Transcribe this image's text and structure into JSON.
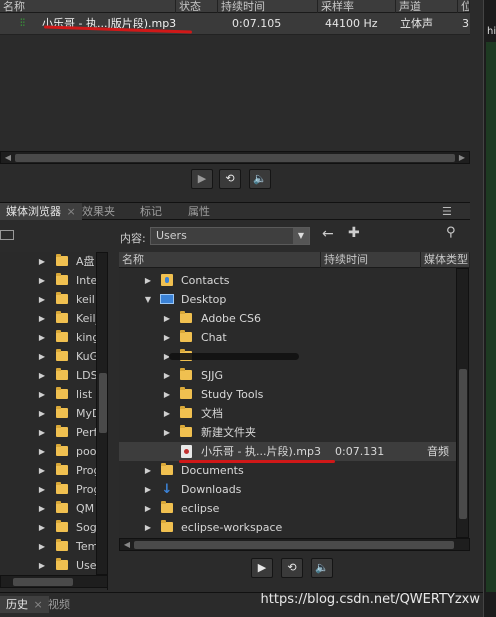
{
  "top_panel": {
    "columns": [
      "名称",
      "状态",
      "持续时间",
      "采样率",
      "声道",
      "位",
      "3"
    ],
    "file": {
      "name": "小乐哥 - 执...J版片段).mp3",
      "duration": "0:07.105",
      "sample_rate": "44100 Hz",
      "channels": "立体声",
      "bits": "3"
    },
    "transport": [
      "play-icon",
      "loop-icon",
      "volume-icon"
    ]
  },
  "tabs": {
    "media_browser": "媒体浏览器",
    "media_browser_close": "×",
    "effects": "效果夹",
    "markers": "标记",
    "properties": "属性",
    "menu": "☰"
  },
  "content": {
    "label": "内容:",
    "location": "Users"
  },
  "left_tree": {
    "items": [
      "A盘",
      "Inte",
      "keil",
      "Keil_",
      "king",
      "KuG",
      "LDS",
      "list",
      "MyD",
      "Perf",
      "pool",
      "Prog",
      "Prog",
      "QM",
      "Sog",
      "Tem",
      "Use"
    ]
  },
  "list": {
    "header": {
      "name": "名称",
      "duration": "持续时间",
      "media_type": "媒体类型"
    },
    "rows": [
      {
        "name": "Contacts",
        "type": "contacts"
      },
      {
        "name": "Desktop",
        "type": "desktop"
      },
      {
        "name": "Adobe CS6",
        "type": "folder"
      },
      {
        "name": "Chat",
        "type": "folder"
      },
      {
        "name": "",
        "type": "folder"
      },
      {
        "name": "SJJG",
        "type": "folder"
      },
      {
        "name": "Study Tools",
        "type": "folder"
      },
      {
        "name": "文档",
        "type": "folder"
      },
      {
        "name": "新建文件夹",
        "type": "folder"
      },
      {
        "name": "小乐哥 - 执...片段).mp3",
        "type": "file",
        "duration": "0:07.131",
        "media_type": "音频"
      },
      {
        "name": "Documents",
        "type": "folder"
      },
      {
        "name": "Downloads",
        "type": "downloads"
      },
      {
        "name": "eclipse",
        "type": "folder"
      },
      {
        "name": "eclipse-workspace",
        "type": "folder"
      }
    ]
  },
  "bottom_tabs": {
    "history": "历史",
    "history_close": "×",
    "video": "视频"
  },
  "right_strip": {
    "label": "hi"
  },
  "watermark": "https://blog.csdn.net/QWERTYzxw",
  "colors": {
    "accent": "#3b82d6",
    "folder": "#f0c050",
    "annotation": "#d01818"
  }
}
